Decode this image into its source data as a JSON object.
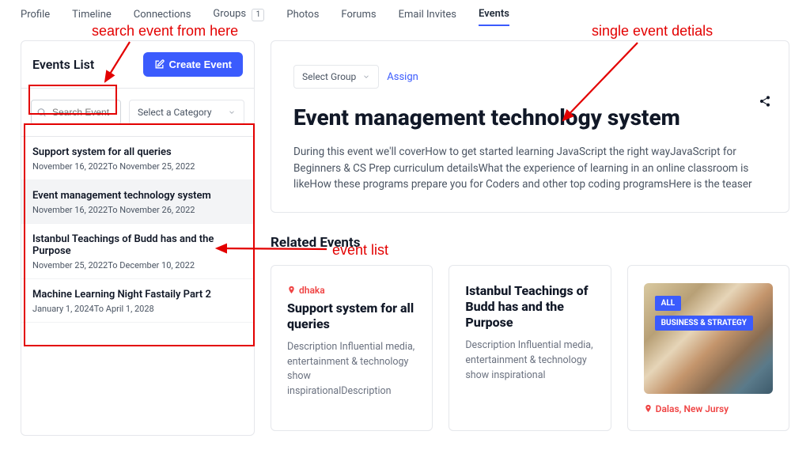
{
  "nav": {
    "items": [
      "Profile",
      "Timeline",
      "Connections",
      "Groups",
      "Photos",
      "Forums",
      "Email Invites",
      "Events"
    ],
    "groups_badge": "1",
    "active": "Events"
  },
  "left": {
    "title": "Events List",
    "create_label": "Create Event",
    "search_placeholder": "Search Event",
    "category_label": "Select a Category",
    "events": [
      {
        "title": "Support system for all queries",
        "dates": "November 16, 2022To November 25, 2022"
      },
      {
        "title": "Event management technology system",
        "dates": "November 16, 2022To November 26, 2022"
      },
      {
        "title": "Istanbul Teachings of Budd has and the Purpose",
        "dates": "November 25, 2022To December 10, 2022"
      },
      {
        "title": "Machine Learning Night Fastaily Part 2",
        "dates": "January 1, 2024To April 1, 2028"
      }
    ],
    "selected_index": 1
  },
  "detail": {
    "group_select": "Select Group",
    "assign": "Assign",
    "title": "Event management technology system",
    "description": "During this event we'll coverHow to get started learning JavaScript the right wayJavaScript for Beginners & CS Prep curriculum detailsWhat the experience of learning in an online classroom is likeHow these programs prepare you for Coders and other top coding programsHere is the teaser"
  },
  "related": {
    "heading": "Related Events",
    "cards": [
      {
        "location": "dhaka",
        "title": "Support system for all queries",
        "desc": "Description Influential media, entertainment & technology show inspirationalDescription"
      },
      {
        "location": "",
        "title": "Istanbul Teachings of Budd has and the Purpose",
        "desc": "Description Influential media, entertainment & technology show inspirational"
      },
      {
        "location": "Dalas, New Jursy",
        "title": "",
        "desc": "",
        "tags": [
          "ALL",
          "BUSINESS & STRATEGY"
        ]
      }
    ]
  },
  "annotations": {
    "search_label": "search event from here",
    "detail_label": "single event detials",
    "list_label": "event list"
  }
}
